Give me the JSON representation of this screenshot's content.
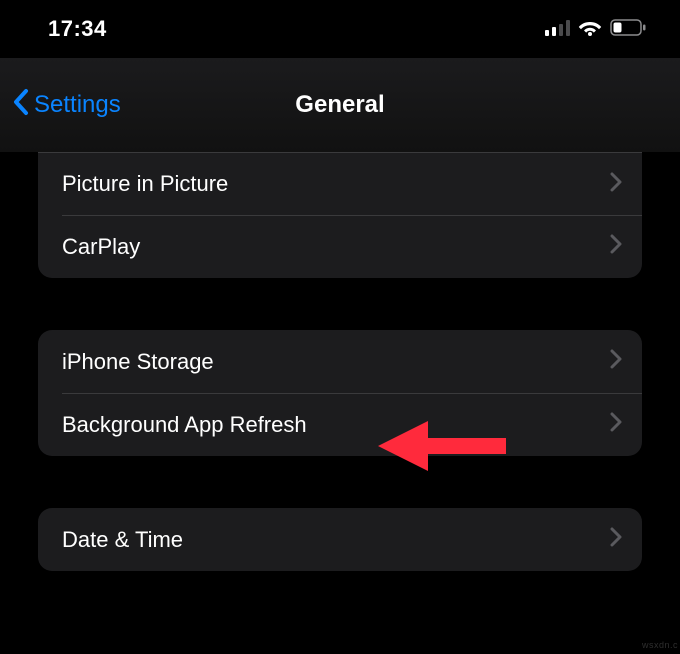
{
  "statusbar": {
    "time": "17:34"
  },
  "nav": {
    "back_label": "Settings",
    "title": "General"
  },
  "groups": {
    "g1": {
      "picture_in_picture": "Picture in Picture",
      "carplay": "CarPlay"
    },
    "g2": {
      "iphone_storage": "iPhone Storage",
      "background_app_refresh": "Background App Refresh"
    },
    "g3": {
      "date_time": "Date & Time"
    }
  },
  "icons": {
    "cellular": "cellular-signal-2-of-4",
    "wifi": "wifi-icon",
    "battery": "battery-low-icon",
    "back_chevron": "chevron-left-icon",
    "disclosure": "chevron-right-icon"
  },
  "annotation": {
    "type": "arrow",
    "color": "#ff2a3c",
    "target": "background_app_refresh"
  },
  "watermark": "wsxdn.c"
}
